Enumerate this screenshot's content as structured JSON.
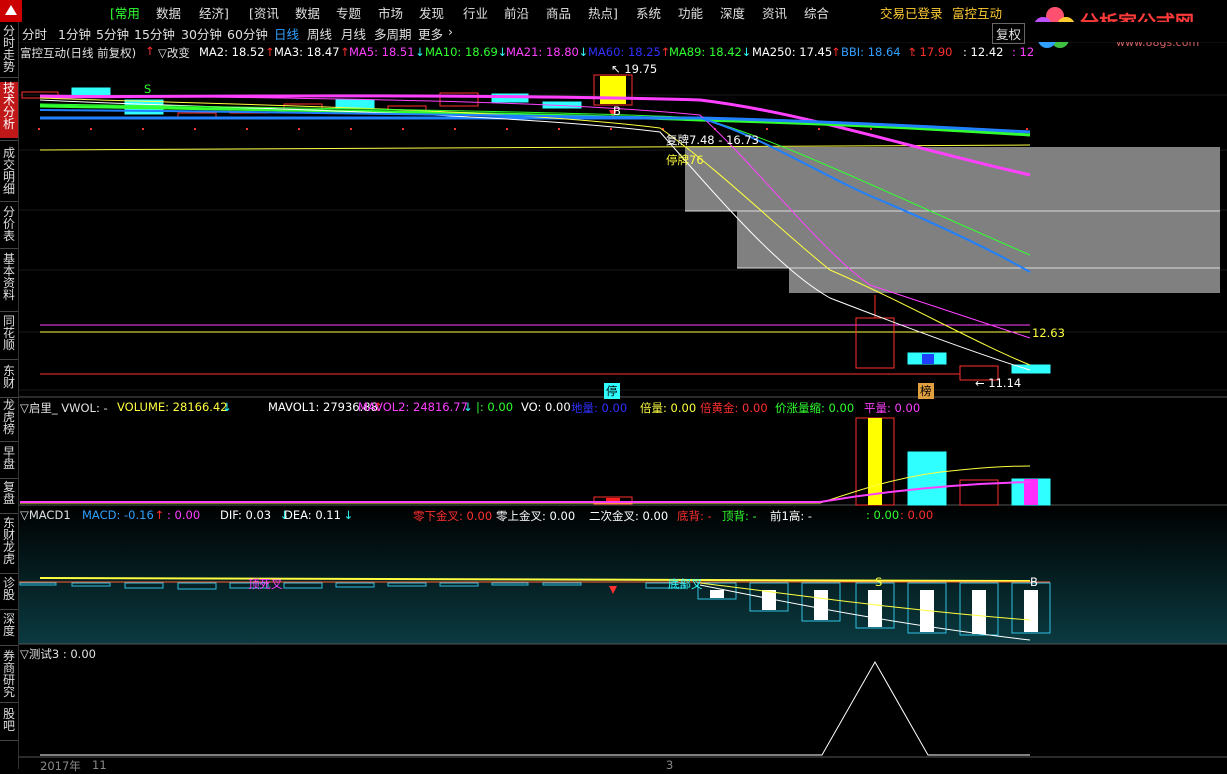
{
  "menu": {
    "logo_icon": "app-logo-icon",
    "items": [
      "[常用",
      "数据",
      "经济]",
      "[资讯",
      "数据",
      "专题",
      "市场",
      "发现",
      "行业",
      "前沿",
      "商品",
      "热点]",
      "系统",
      "功能",
      "深度",
      "资讯",
      "综合"
    ],
    "status": "交易已登录",
    "stock_name": "富控互动"
  },
  "watermark": {
    "title": "分析家公式网",
    "url": "www.88gs.com"
  },
  "timeframes": [
    "分时",
    "1分钟",
    "5分钟",
    "15分钟",
    "30分钟",
    "60分钟",
    "日线",
    "周线",
    "月线",
    "多周期",
    "更多"
  ],
  "timeframe_active": "日线",
  "fuquan_label": "复权",
  "sidebar": [
    {
      "name": "fenshi",
      "label": "分时走势"
    },
    {
      "name": "jishu",
      "label": "技术分析",
      "active": true
    },
    {
      "name": "chengjiao",
      "label": "成交明细"
    },
    {
      "name": "fenjia",
      "label": "分价表"
    },
    {
      "name": "jiben",
      "label": "基本资料"
    },
    {
      "name": "tonghuashun",
      "label": "同花顺"
    },
    {
      "name": "dongcai",
      "label": "东财"
    },
    {
      "name": "longhu",
      "label": "龙虎榜"
    },
    {
      "name": "zaopan",
      "label": "早盘"
    },
    {
      "name": "fupan",
      "label": "复盘"
    },
    {
      "name": "dongcailonghu",
      "label": "东财龙虎"
    },
    {
      "name": "zhengu",
      "label": "诊股"
    },
    {
      "name": "shendu",
      "label": "深度"
    },
    {
      "name": "quanshang",
      "label": "券商研究"
    },
    {
      "name": "guba",
      "label": "股吧"
    }
  ],
  "main_pane": {
    "title": "富控互动(日线 前复权)",
    "indicator": "▽改变",
    "ma_labels": [
      {
        "text": "MA2: 18.52",
        "color": "#ffffff",
        "arrow": "↑",
        "arrow_color": "#ff3030"
      },
      {
        "text": "MA3: 18.47",
        "color": "#ffffff",
        "arrow": "↑",
        "arrow_color": "#ff3030"
      },
      {
        "text": "MA5: 18.51",
        "color": "#ff40ff",
        "arrow": "↓",
        "arrow_color": "#30ffff"
      },
      {
        "text": "MA10: 18.69",
        "color": "#30ff30",
        "arrow": "↓",
        "arrow_color": "#30ffff"
      },
      {
        "text": "MA21: 18.80",
        "color": "#ff40ff",
        "arrow": "↓",
        "arrow_color": "#30ffff"
      },
      {
        "text": "MA60: 18.25",
        "color": "#3030ff",
        "arrow": "↑",
        "arrow_color": "#ff3030"
      },
      {
        "text": "MA89: 18.42",
        "color": "#30ff30",
        "arrow": "↓",
        "arrow_color": "#30ffff"
      },
      {
        "text": "MA250: 17.45",
        "color": "#ffffff",
        "arrow": "↑",
        "arrow_color": "#ff3030"
      },
      {
        "text": "BBI: 18.64",
        "color": "#30a0ff",
        "arrow": "↑",
        "arrow_color": "#ff3030"
      },
      {
        "text": ": 17.90",
        "color": "#ff3030",
        "arrow": "",
        "arrow_color": ""
      },
      {
        "text": ": 12.42",
        "color": "#ffffff",
        "arrow": "",
        "arrow_color": ""
      },
      {
        "text": ": 12",
        "color": "#ff40ff",
        "arrow": "",
        "arrow_color": ""
      }
    ],
    "annotations": {
      "high": "19.75",
      "low": "11.14",
      "level": "12.63",
      "fupai": "复牌7.48 - 16.73",
      "tingpai": "停牌76",
      "s_mark": "S",
      "b_mark": "B",
      "ting_badge": "停",
      "bang_badge": "榜"
    }
  },
  "volume_pane": {
    "title": "▽启里_ VWOL: -",
    "labels": [
      {
        "text": "VOLUME: 28166.42",
        "color": "#ffff40",
        "arrow": "↓",
        "arrow_color": "#30ffff"
      },
      {
        "text": "MAVOL1: 27936.88",
        "color": "#ffffff",
        "arrow": "↑",
        "arrow_color": "#ff3030"
      },
      {
        "text": "MAVOL2: 24816.77",
        "color": "#ff40ff",
        "arrow": "↓",
        "arrow_color": "#30ffff"
      },
      {
        "text": "|: 0.00",
        "color": "#30ff30",
        "arrow": "",
        "arrow_color": ""
      },
      {
        "text": "VO: 0.00",
        "color": "#ffffff",
        "arrow": "",
        "arrow_color": ""
      },
      {
        "text": "地量: 0.00",
        "color": "#3030ff",
        "arrow": "",
        "arrow_color": ""
      },
      {
        "text": "倍量: 0.00",
        "color": "#ffff40",
        "arrow": "",
        "arrow_color": ""
      },
      {
        "text": "倍黄金: 0.00",
        "color": "#ff3030",
        "arrow": "",
        "arrow_color": ""
      },
      {
        "text": "价涨量缩: 0.00",
        "color": "#30ff30",
        "arrow": "",
        "arrow_color": ""
      },
      {
        "text": "平量: 0.00",
        "color": "#ff40ff",
        "arrow": "",
        "arrow_color": ""
      }
    ]
  },
  "macd_pane": {
    "title": "▽MACD1",
    "labels": [
      {
        "text": "MACD: -0.16",
        "color": "#30a0ff",
        "arrow": "↑",
        "arrow_color": "#ff3030"
      },
      {
        "text": ": 0.00",
        "color": "#ff40ff",
        "arrow": "",
        "arrow_color": ""
      },
      {
        "text": "DIF: 0.03",
        "color": "#ffffff",
        "arrow": "↓",
        "arrow_color": "#30ffff"
      },
      {
        "text": "DEA: 0.11",
        "color": "#ffffff",
        "arrow": "↓",
        "arrow_color": "#30ffff"
      },
      {
        "text": "零下金叉: 0.00",
        "color": "#ff3030",
        "arrow": "",
        "arrow_color": ""
      },
      {
        "text": "零上金叉: 0.00",
        "color": "#ffffff",
        "arrow": "",
        "arrow_color": ""
      },
      {
        "text": "二次金叉: 0.00",
        "color": "#ffffff",
        "arrow": "",
        "arrow_color": ""
      },
      {
        "text": "底背: -",
        "color": "#ff3030",
        "arrow": "",
        "arrow_color": ""
      },
      {
        "text": "顶背: -",
        "color": "#30ff30",
        "arrow": "",
        "arrow_color": ""
      },
      {
        "text": "前1高: -",
        "color": "#ffffff",
        "arrow": "",
        "arrow_color": ""
      },
      {
        "text": ": 0.00",
        "color": "#30ff30",
        "arrow": "",
        "arrow_color": ""
      },
      {
        "text": ": 0.00",
        "color": "#ff3030",
        "arrow": "",
        "arrow_color": ""
      }
    ],
    "marks": {
      "dead": "顶死叉",
      "gold": "底部叉",
      "s": "S",
      "b": "B"
    }
  },
  "test_pane": {
    "title": "▽测试3 : 0.00"
  },
  "xaxis": {
    "labels": [
      "2017年",
      "11",
      "3"
    ]
  },
  "colors": {
    "up": "#ff3030",
    "down": "#30ffff",
    "ma_white": "#ffffff",
    "ma_yellow": "#ffff40",
    "ma_magenta": "#ff40ff",
    "ma_green": "#30ff30",
    "ma_blue": "#2080ff",
    "gap_gray": "#808080"
  }
}
